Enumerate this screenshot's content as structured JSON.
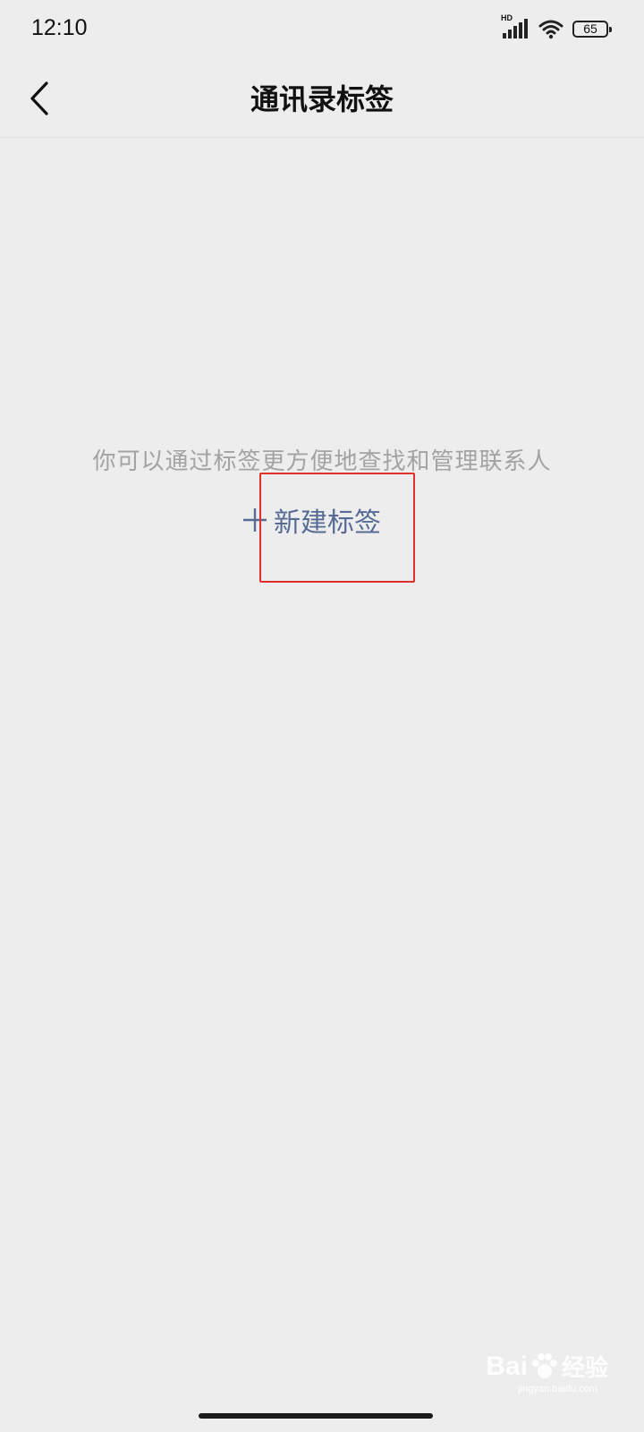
{
  "status_bar": {
    "time": "12:10",
    "network_label": "HD",
    "battery_level": "65",
    "icons": [
      "signal-icon",
      "wifi-icon",
      "battery-icon"
    ]
  },
  "nav": {
    "title": "通讯录标签",
    "back_icon": "chevron-left-icon"
  },
  "empty_state": {
    "hint": "你可以通过标签更方便地查找和管理联系人",
    "new_tag_label": "新建标签",
    "new_tag_icon": "plus-icon"
  },
  "watermark": {
    "brand": "Bai",
    "brand_suffix": "经验",
    "url": "jingyan.baidu.com"
  },
  "colors": {
    "background": "#ededed",
    "link": "#576b95",
    "hint": "#a3a3a3",
    "highlight": "#e0302c"
  }
}
